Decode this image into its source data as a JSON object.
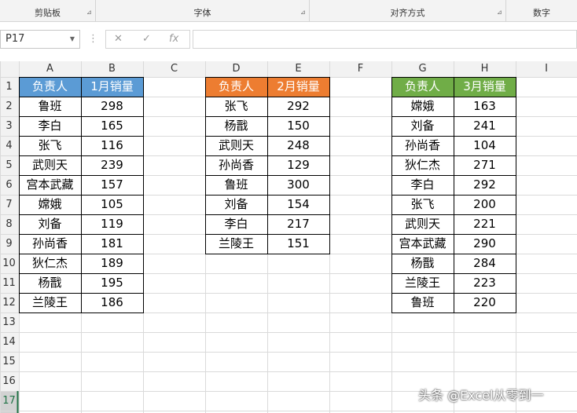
{
  "ribbon": {
    "groups": [
      "剪贴板",
      "字体",
      "对齐方式",
      "数字"
    ]
  },
  "formula_bar": {
    "name_box": "P17",
    "cancel_icon": "✕",
    "confirm_icon": "✓",
    "function_icon": "fx",
    "formula": ""
  },
  "columns": [
    "A",
    "B",
    "C",
    "D",
    "E",
    "F",
    "G",
    "H",
    "I"
  ],
  "rows": [
    "1",
    "2",
    "3",
    "4",
    "5",
    "6",
    "7",
    "8",
    "9",
    "10",
    "11",
    "12",
    "13",
    "14",
    "15",
    "16",
    "17"
  ],
  "colors": {
    "table1_header": "#5b9bd5",
    "table2_header": "#ed7d31",
    "table3_header": "#70ad47",
    "active_row": "#217346"
  },
  "tables": [
    {
      "header": [
        "负责人",
        "1月销量"
      ],
      "rows": [
        [
          "鲁班",
          "298"
        ],
        [
          "李白",
          "165"
        ],
        [
          "张飞",
          "116"
        ],
        [
          "武则天",
          "239"
        ],
        [
          "宫本武藏",
          "157"
        ],
        [
          "嫦娥",
          "105"
        ],
        [
          "刘备",
          "119"
        ],
        [
          "孙尚香",
          "181"
        ],
        [
          "狄仁杰",
          "189"
        ],
        [
          "杨戬",
          "195"
        ],
        [
          "兰陵王",
          "186"
        ]
      ]
    },
    {
      "header": [
        "负责人",
        "2月销量"
      ],
      "rows": [
        [
          "张飞",
          "292"
        ],
        [
          "杨戬",
          "150"
        ],
        [
          "武则天",
          "248"
        ],
        [
          "孙尚香",
          "129"
        ],
        [
          "鲁班",
          "300"
        ],
        [
          "刘备",
          "154"
        ],
        [
          "李白",
          "217"
        ],
        [
          "兰陵王",
          "151"
        ]
      ]
    },
    {
      "header": [
        "负责人",
        "3月销量"
      ],
      "rows": [
        [
          "嫦娥",
          "163"
        ],
        [
          "刘备",
          "241"
        ],
        [
          "孙尚香",
          "104"
        ],
        [
          "狄仁杰",
          "271"
        ],
        [
          "李白",
          "292"
        ],
        [
          "张飞",
          "200"
        ],
        [
          "武则天",
          "221"
        ],
        [
          "宫本武藏",
          "290"
        ],
        [
          "杨戬",
          "284"
        ],
        [
          "兰陵王",
          "223"
        ],
        [
          "鲁班",
          "220"
        ]
      ]
    }
  ],
  "watermark": "头条 @Excel从零到一"
}
